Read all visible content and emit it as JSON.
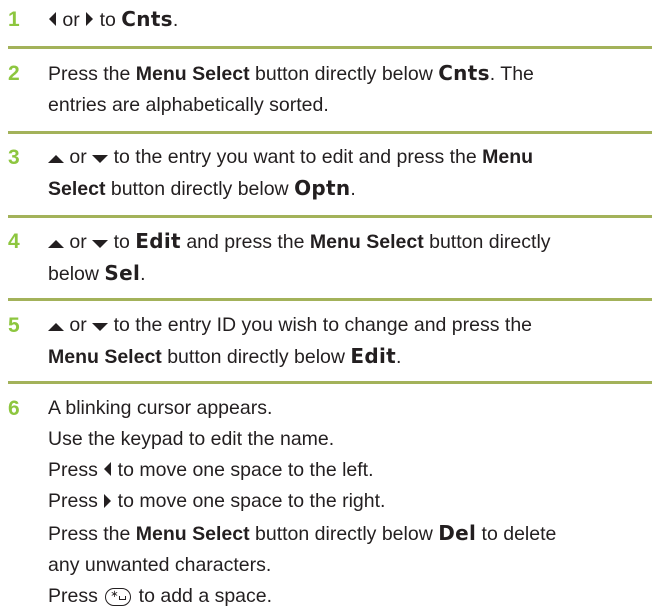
{
  "steps": [
    {
      "number": "1",
      "lines": [
        [
          {
            "t": "icon",
            "name": "left-arrow-icon"
          },
          {
            "t": "text",
            "v": " or "
          },
          {
            "t": "icon",
            "name": "right-arrow-icon"
          },
          {
            "t": "text",
            "v": " to "
          },
          {
            "t": "lcd",
            "v": "Cnts"
          },
          {
            "t": "text",
            "v": "."
          }
        ]
      ]
    },
    {
      "number": "2",
      "lines": [
        [
          {
            "t": "text",
            "v": "Press the "
          },
          {
            "t": "bold",
            "v": "Menu Select"
          },
          {
            "t": "text",
            "v": " button directly below "
          },
          {
            "t": "lcd",
            "v": "Cnts"
          },
          {
            "t": "text",
            "v": ". The"
          }
        ],
        [
          {
            "t": "text",
            "v": "entries are alphabetically sorted."
          }
        ]
      ]
    },
    {
      "number": "3",
      "lines": [
        [
          {
            "t": "icon",
            "name": "up-arrow-icon"
          },
          {
            "t": "text",
            "v": " or "
          },
          {
            "t": "icon",
            "name": "down-arrow-icon"
          },
          {
            "t": "text",
            "v": " to the entry you want to edit and press the "
          },
          {
            "t": "bold",
            "v": "Menu"
          }
        ],
        [
          {
            "t": "bold",
            "v": "Select"
          },
          {
            "t": "text",
            "v": " button directly below "
          },
          {
            "t": "lcd",
            "v": "Optn"
          },
          {
            "t": "text",
            "v": "."
          }
        ]
      ]
    },
    {
      "number": "4",
      "lines": [
        [
          {
            "t": "icon",
            "name": "up-arrow-icon"
          },
          {
            "t": "text",
            "v": " or "
          },
          {
            "t": "icon",
            "name": "down-arrow-icon"
          },
          {
            "t": "text",
            "v": " to "
          },
          {
            "t": "lcd",
            "v": "Edit"
          },
          {
            "t": "text",
            "v": " and press the "
          },
          {
            "t": "bold",
            "v": "Menu Select"
          },
          {
            "t": "text",
            "v": " button directly"
          }
        ],
        [
          {
            "t": "text",
            "v": "below "
          },
          {
            "t": "lcd",
            "v": "Sel"
          },
          {
            "t": "text",
            "v": "."
          }
        ]
      ]
    },
    {
      "number": "5",
      "lines": [
        [
          {
            "t": "icon",
            "name": "up-arrow-icon"
          },
          {
            "t": "text",
            "v": " or "
          },
          {
            "t": "icon",
            "name": "down-arrow-icon"
          },
          {
            "t": "text",
            "v": " to the entry ID you wish to change and press the"
          }
        ],
        [
          {
            "t": "bold",
            "v": "Menu Select"
          },
          {
            "t": "text",
            "v": " button directly below "
          },
          {
            "t": "lcd",
            "v": "Edit"
          },
          {
            "t": "text",
            "v": "."
          }
        ]
      ]
    },
    {
      "number": "6",
      "lines": [
        [
          {
            "t": "text",
            "v": "A blinking cursor appears."
          }
        ],
        [
          {
            "t": "text",
            "v": "Use the keypad to edit the name."
          }
        ],
        [
          {
            "t": "text",
            "v": "Press "
          },
          {
            "t": "icon",
            "name": "left-arrow-icon"
          },
          {
            "t": "text",
            "v": " to move one space to the left."
          }
        ],
        [
          {
            "t": "text",
            "v": "Press "
          },
          {
            "t": "icon",
            "name": "right-arrow-icon"
          },
          {
            "t": "text",
            "v": " to move one space to the right."
          }
        ],
        [
          {
            "t": "text",
            "v": "Press the "
          },
          {
            "t": "bold",
            "v": "Menu Select"
          },
          {
            "t": "text",
            "v": " button directly below "
          },
          {
            "t": "lcd",
            "v": "Del"
          },
          {
            "t": "text",
            "v": " to delete"
          }
        ],
        [
          {
            "t": "text",
            "v": "any unwanted characters."
          }
        ],
        [
          {
            "t": "text",
            "v": "Press "
          },
          {
            "t": "icon",
            "name": "star-space-key-icon"
          },
          {
            "t": "text",
            "v": " to add a space."
          }
        ]
      ]
    }
  ],
  "colors": {
    "step_number": "#8dc63f",
    "rule": "#a3b25a",
    "text": "#231f20"
  }
}
